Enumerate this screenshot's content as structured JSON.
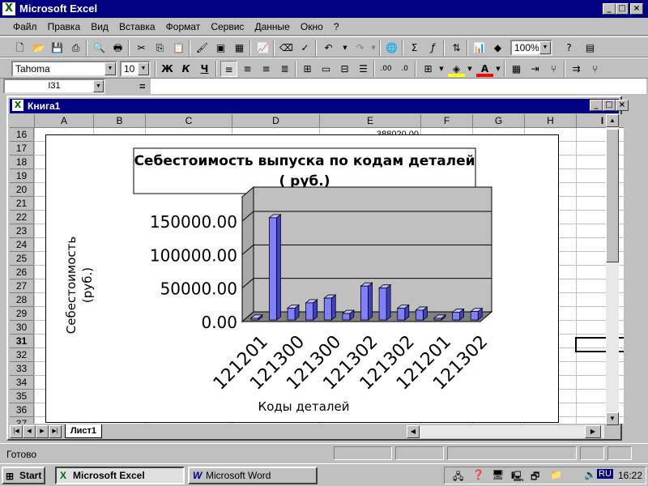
{
  "app": {
    "title": "Microsoft Excel"
  },
  "menu": [
    "Файл",
    "Правка",
    "Вид",
    "Вставка",
    "Формат",
    "Сервис",
    "Данные",
    "Окно",
    "?"
  ],
  "toolbar": {
    "font": "Tahoma",
    "size": "10",
    "zoom": "100%",
    "bold": "Ж",
    "italic": "К",
    "underline": "Ч"
  },
  "formula": {
    "name_box": "I31",
    "equals": "="
  },
  "workbook": {
    "title": "Книга1",
    "sheet_tab": "Лист1"
  },
  "columns": [
    "A",
    "B",
    "C",
    "D",
    "E",
    "F",
    "G",
    "H",
    "I"
  ],
  "rows": [
    "16",
    "17",
    "18",
    "19",
    "20",
    "21",
    "22",
    "23",
    "24",
    "25",
    "26",
    "27",
    "28",
    "29",
    "30",
    "31",
    "32",
    "33",
    "34",
    "35",
    "36",
    "37"
  ],
  "cell_e16": "388020.00",
  "chart_data": {
    "type": "bar",
    "title": "Себестоимость выпуска по кодам деталей ( руб.)",
    "xlabel": "Коды деталей",
    "ylabel": "Себестоимость (руб.)",
    "ylim": [
      0,
      150000
    ],
    "yticks": [
      "0.00",
      "50000.00",
      "100000.00",
      "150000.00"
    ],
    "tick_labels": [
      "121201",
      "121300",
      "121300",
      "121302",
      "121302",
      "121201",
      "121302"
    ],
    "values": [
      5000,
      155000,
      20000,
      28000,
      35000,
      12000,
      53000,
      50000,
      20000,
      17000,
      5000,
      14000,
      15000
    ],
    "bar_color": "#8080ff",
    "wall_color": "#c0c0c0"
  },
  "status": {
    "text": "Готово"
  },
  "taskbar": {
    "start": "Start",
    "excel": "Microsoft Excel",
    "word": "Microsoft Word",
    "lang": "RU",
    "time": "16:22"
  }
}
